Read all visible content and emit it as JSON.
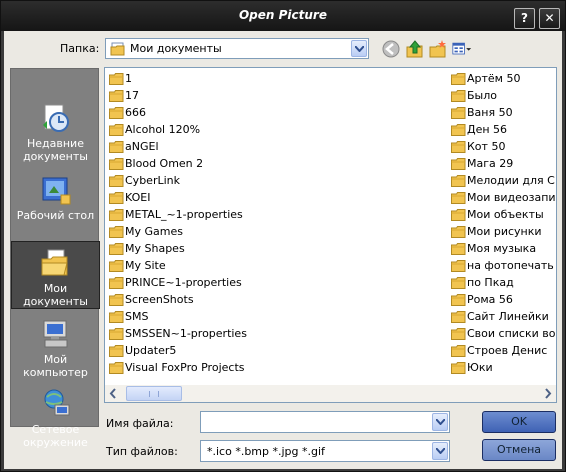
{
  "window": {
    "title": "Open Picture",
    "help_label": "?",
    "close_label": "✕"
  },
  "lookin": {
    "label": "Папка:",
    "value": "Мои документы"
  },
  "places": [
    {
      "name": "recent",
      "label": "Недавние документы",
      "icon": "recent-documents-icon"
    },
    {
      "name": "desktop",
      "label": "Рабочий стол",
      "icon": "desktop-icon"
    },
    {
      "name": "my-documents",
      "label": "Мои документы",
      "icon": "my-documents-icon",
      "selected": true
    },
    {
      "name": "my-computer",
      "label": "Мой компьютер",
      "icon": "my-computer-icon"
    },
    {
      "name": "network",
      "label": "Сетевое окружение",
      "icon": "network-icon"
    }
  ],
  "files_col1": [
    "1",
    "17",
    "666",
    "Alcohol 120%",
    "aNGEl",
    "Blood Omen 2",
    "CyberLink",
    "KOEI",
    "METAL_~1-properties",
    "My Games",
    "My Shapes",
    "My Site",
    "PRINCE~1-properties",
    "ScreenShots",
    "SMS",
    "SMSSEN~1-properties",
    "Updater5",
    "Visual FoxPro Projects"
  ],
  "files_col2": [
    "Артём 50",
    "Было",
    "Ваня 50",
    "Ден 56",
    "Кот 50",
    "Мага 29",
    "Мелодии для Сим",
    "Мои видеозаписи",
    "Мои объекты",
    "Мои рисунки",
    "Моя музыка",
    "на фотопечать",
    "по Пкад",
    "Рома 56",
    "Сайт Линейки",
    "Свои списки восп",
    "Строев Денис",
    "Юки"
  ],
  "filename": {
    "label": "Имя файла:",
    "value": ""
  },
  "filetype": {
    "label": "Тип файлов:",
    "value": "*.ico *.bmp *.jpg *.gif"
  },
  "buttons": {
    "ok": "OK",
    "cancel": "Отмена"
  },
  "colors": {
    "accent": "#4a6fc0",
    "folder": "#f1c450"
  }
}
